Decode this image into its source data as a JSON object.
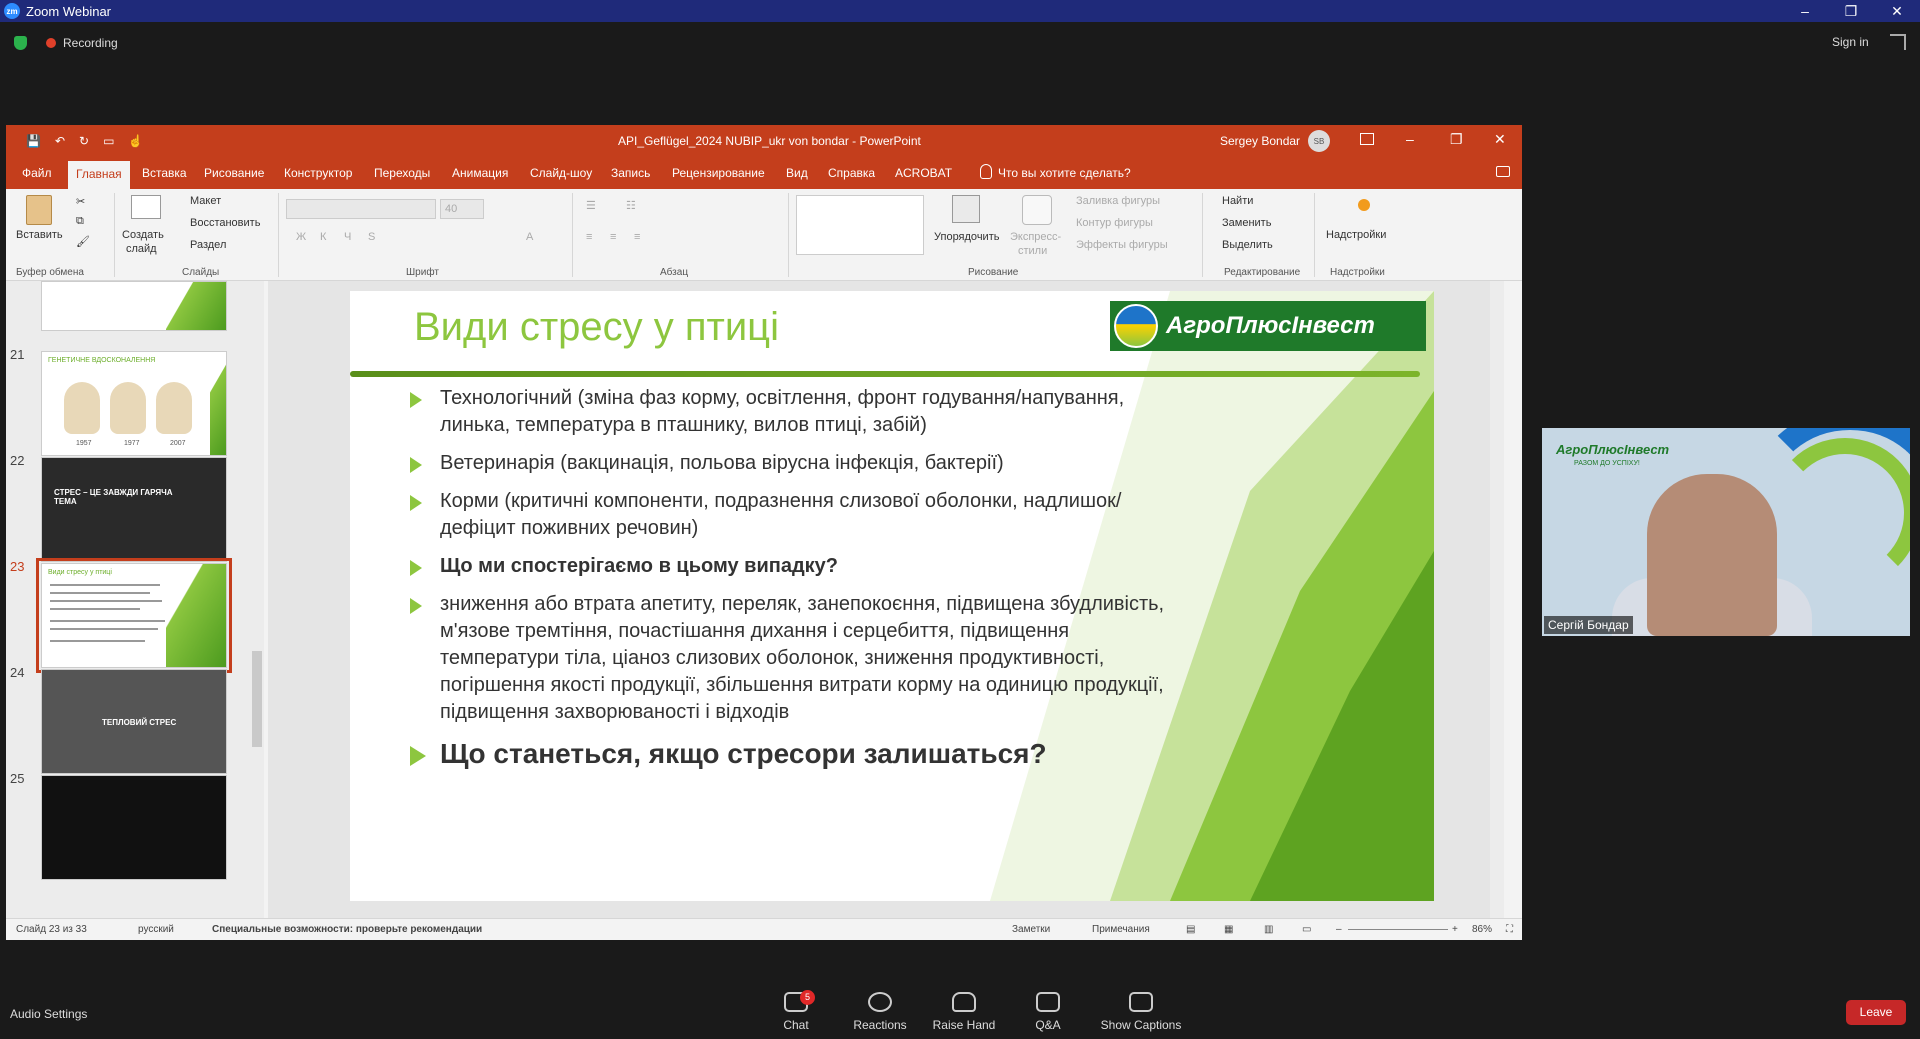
{
  "zoom": {
    "window_title": "Zoom Webinar",
    "recording_label": "Recording",
    "sign_in": "Sign in",
    "window_controls": [
      "–",
      "❐",
      "✕"
    ],
    "bottom": {
      "audio_settings": "Audio Settings",
      "chat": "Chat",
      "chat_badge": "5",
      "reactions": "Reactions",
      "raise_hand": "Raise Hand",
      "qa": "Q&A",
      "captions": "Show Captions",
      "leave": "Leave"
    }
  },
  "ppt": {
    "doc_title": "API_Geflügel_2024 NUBIP_ukr von bondar  -  PowerPoint",
    "user": "Sergey Bondar",
    "user_initials": "SB",
    "tabs": [
      "Файл",
      "Главная",
      "Вставка",
      "Рисование",
      "Конструктор",
      "Переходы",
      "Анимация",
      "Слайд-шоу",
      "Запись",
      "Рецензирование",
      "Вид",
      "Справка",
      "ACROBAT",
      "Что вы хотите сделать?"
    ],
    "ribbon": {
      "paste": "Вставить",
      "clipboard": "Буфер обмена",
      "new_slide": "Создать",
      "new_slide2": "слайд",
      "layout": "Макет",
      "reset": "Восстановить",
      "section": "Раздел",
      "slides": "Слайды",
      "font": "Шрифт",
      "font_size": "40",
      "paragraph": "Абзац",
      "arrange": "Упорядочить",
      "quick_styles": "Экспресс-",
      "quick_styles2": "стили",
      "shape_fill": "Заливка фигуры",
      "shape_outline": "Контур фигуры",
      "shape_effects": "Эффекты фигуры",
      "drawing": "Рисование",
      "find": "Найти",
      "replace": "Заменить",
      "select": "Выделить",
      "editing": "Редактирование",
      "addins": "Надстройки",
      "addins_group": "Надстройки"
    },
    "thumbnails": [
      {
        "num": "21",
        "title": "ГЕНЕТИЧНЕ ВДОСКОНАЛЕННЯ"
      },
      {
        "num": "22",
        "caption": "СТРЕС – ЦЕ ЗАВЖДИ ГАРЯЧА ТЕМА"
      },
      {
        "num": "23",
        "title": "Види стресу у птиці"
      },
      {
        "num": "24",
        "caption": "ТЕПЛОВИЙ СТРЕС"
      },
      {
        "num": "25"
      }
    ],
    "thumb21_years": [
      "1957",
      "1977",
      "2007"
    ],
    "slide": {
      "title": "Види стресу у птиці",
      "logo": "АгроПлюсІнвест",
      "bullets": [
        "Технологічний (зміна фаз корму, освітлення, фронт годування/напування, линька, температура в пташнику, вилов птиці, забій)",
        "Ветеринарія (вакцинація, польова вірусна інфекція, бактерії)",
        "Корми (критичні компоненти, подразнення слизової оболонки, надлишок/дефіцит поживних речовин)",
        "Що ми спостерігаємо в цьому випадку?",
        "зниження або втрата апетиту, переляк, занепокоєння, підвищена збудливість, м'язове тремтіння, почастішання дихання і серцебиття, підвищення температури тіла, ціаноз слизових оболонок, зниження продуктивності, погіршення якості продукції, збільшення витрати корму на одиницю продукції, підвищення захворюваності і відходів",
        "Що станеться, якщо стресори залишаться?"
      ]
    },
    "status": {
      "slide_count": "Слайд 23 из 33",
      "language": "русский",
      "accessibility": "Специальные возможности: проверьте рекомендации",
      "notes": "Заметки",
      "comments": "Примечания",
      "zoom": "86%"
    }
  },
  "video": {
    "logo": "АгроПлюсІнвест",
    "slogan": "РАЗОМ ДО УСПІХУ!",
    "name": "Сергій Бондар"
  }
}
